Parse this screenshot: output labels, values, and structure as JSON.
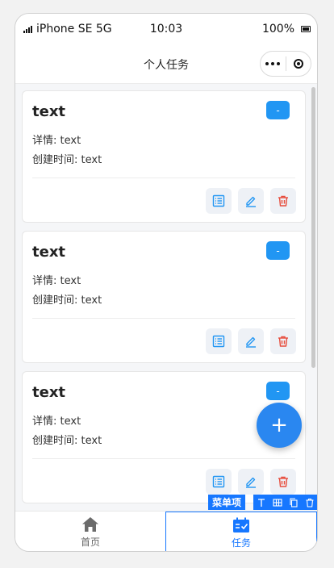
{
  "status": {
    "carrier": "iPhone SE 5G",
    "time": "10:03",
    "battery": "100%"
  },
  "navbar": {
    "title": "个人任务",
    "more_icon": "more-dots-icon",
    "close_icon": "target-icon"
  },
  "tasks": [
    {
      "title": "text",
      "detail": "详情: text",
      "created": "创建时间: text",
      "badge": "-"
    },
    {
      "title": "text",
      "detail": "详情: text",
      "created": "创建时间: text",
      "badge": "-"
    },
    {
      "title": "text",
      "detail": "详情: text",
      "created": "创建时间: text",
      "badge": "-"
    }
  ],
  "actions": {
    "list_icon": "list-icon",
    "edit_icon": "pencil-icon",
    "delete_icon": "trash-icon",
    "list_color": "#2196f3",
    "delete_color": "#e74c3c"
  },
  "fab": {
    "label": "+"
  },
  "editor": {
    "menu_label": "菜单项"
  },
  "tabbar": {
    "items": [
      {
        "label": "首页",
        "icon": "home-icon"
      },
      {
        "label": "任务",
        "icon": "calendar-check-icon"
      }
    ],
    "active_color": "#1677ff"
  }
}
